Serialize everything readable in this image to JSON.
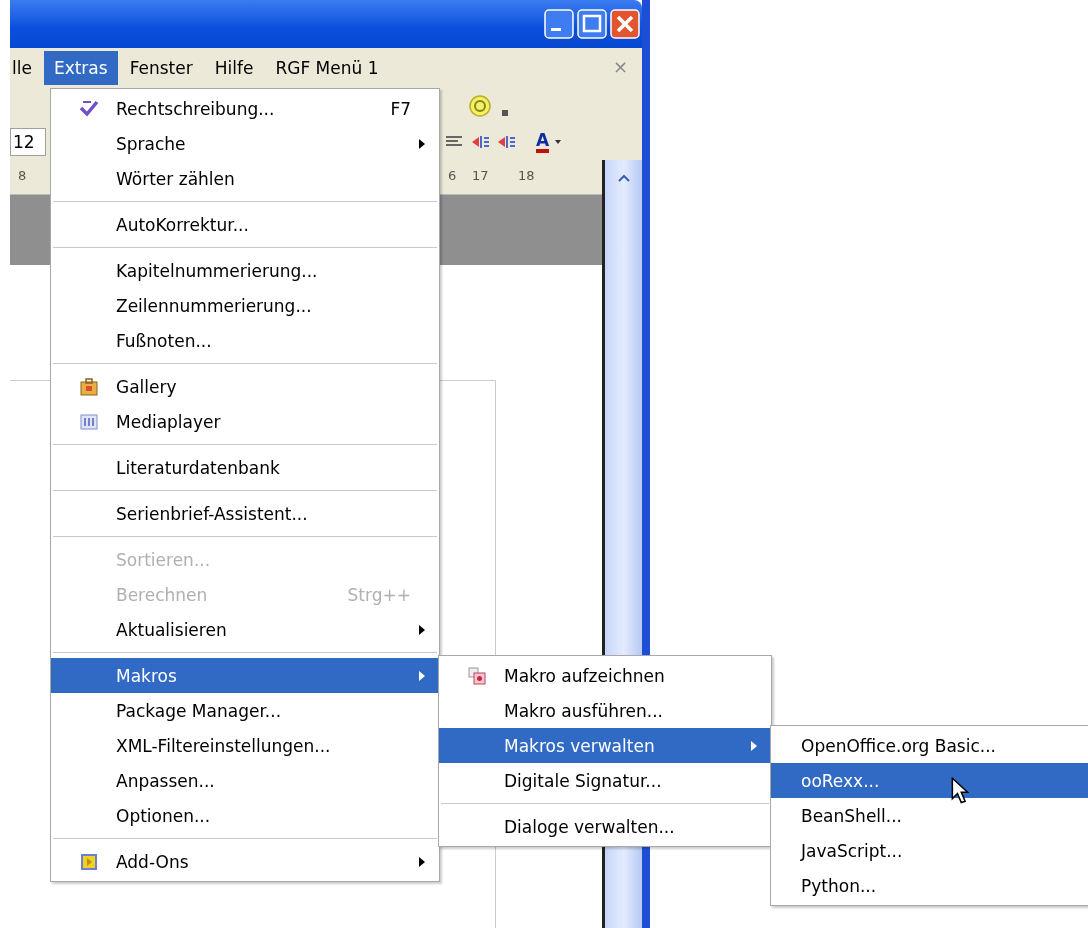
{
  "menubar": [
    {
      "label": "lle",
      "selected": false
    },
    {
      "label": "Extras",
      "selected": true
    },
    {
      "label": "Fenster",
      "selected": false
    },
    {
      "label": "Hilfe",
      "selected": false
    },
    {
      "label": "RGF Menü 1",
      "selected": false
    }
  ],
  "document_close": "×",
  "toolbar": {
    "font_size": "12",
    "font_color_glyph": "A"
  },
  "ruler": [
    "8",
    "6",
    "17",
    "18"
  ],
  "menus": [
    {
      "items": [
        {
          "kind": "item",
          "label": "Rechtschreibung...",
          "shortcut": "F7",
          "has_submenu": false,
          "selected": false,
          "disabled": false
        },
        {
          "kind": "item",
          "label": "Sprache",
          "has_submenu": true,
          "selected": false,
          "disabled": false
        },
        {
          "kind": "item",
          "label": "Wörter zählen",
          "has_submenu": false,
          "selected": false,
          "disabled": false
        },
        {
          "kind": "separator"
        },
        {
          "kind": "item",
          "label": "AutoKorrektur...",
          "has_submenu": false,
          "selected": false,
          "disabled": false
        },
        {
          "kind": "separator"
        },
        {
          "kind": "item",
          "label": "Kapitelnummerierung...",
          "has_submenu": false,
          "selected": false,
          "disabled": false
        },
        {
          "kind": "item",
          "label": "Zeilennummerierung...",
          "has_submenu": false,
          "selected": false,
          "disabled": false
        },
        {
          "kind": "item",
          "label": "Fußnoten...",
          "has_submenu": false,
          "selected": false,
          "disabled": false
        },
        {
          "kind": "separator"
        },
        {
          "kind": "item",
          "label": "Gallery",
          "has_submenu": false,
          "selected": false,
          "disabled": false
        },
        {
          "kind": "item",
          "label": "Mediaplayer",
          "has_submenu": false,
          "selected": false,
          "disabled": false
        },
        {
          "kind": "separator"
        },
        {
          "kind": "item",
          "label": "Literaturdatenbank",
          "has_submenu": false,
          "selected": false,
          "disabled": false
        },
        {
          "kind": "separator"
        },
        {
          "kind": "item",
          "label": "Serienbrief-Assistent...",
          "has_submenu": false,
          "selected": false,
          "disabled": false
        },
        {
          "kind": "separator"
        },
        {
          "kind": "item",
          "label": "Sortieren...",
          "has_submenu": false,
          "selected": false,
          "disabled": true
        },
        {
          "kind": "item",
          "label": "Berechnen",
          "shortcut": "Strg++",
          "has_submenu": false,
          "selected": false,
          "disabled": true
        },
        {
          "kind": "item",
          "label": "Aktualisieren",
          "has_submenu": true,
          "selected": false,
          "disabled": false
        },
        {
          "kind": "separator"
        },
        {
          "kind": "item",
          "label": "Makros",
          "has_submenu": true,
          "selected": true,
          "disabled": false
        },
        {
          "kind": "item",
          "label": "Package Manager...",
          "has_submenu": false,
          "selected": false,
          "disabled": false
        },
        {
          "kind": "item",
          "label": "XML-Filtereinstellungen...",
          "has_submenu": false,
          "selected": false,
          "disabled": false
        },
        {
          "kind": "item",
          "label": "Anpassen...",
          "has_submenu": false,
          "selected": false,
          "disabled": false
        },
        {
          "kind": "item",
          "label": "Optionen...",
          "has_submenu": false,
          "selected": false,
          "disabled": false
        },
        {
          "kind": "separator"
        },
        {
          "kind": "item",
          "label": "Add-Ons",
          "has_submenu": true,
          "selected": false,
          "disabled": false
        }
      ]
    },
    {
      "items": [
        {
          "kind": "item",
          "label": "Makro aufzeichnen",
          "has_submenu": false,
          "selected": false,
          "disabled": false
        },
        {
          "kind": "item",
          "label": "Makro ausführen...",
          "has_submenu": false,
          "selected": false,
          "disabled": false
        },
        {
          "kind": "item",
          "label": "Makros verwalten",
          "has_submenu": true,
          "selected": true,
          "disabled": false
        },
        {
          "kind": "item",
          "label": "Digitale Signatur...",
          "has_submenu": false,
          "selected": false,
          "disabled": false
        },
        {
          "kind": "separator"
        },
        {
          "kind": "item",
          "label": "Dialoge verwalten...",
          "has_submenu": false,
          "selected": false,
          "disabled": false
        }
      ]
    },
    {
      "items": [
        {
          "kind": "item",
          "label": "OpenOffice.org Basic...",
          "has_submenu": false,
          "selected": false,
          "disabled": false
        },
        {
          "kind": "item",
          "label": "ooRexx...",
          "has_submenu": false,
          "selected": true,
          "disabled": false
        },
        {
          "kind": "item",
          "label": "BeanShell...",
          "has_submenu": false,
          "selected": false,
          "disabled": false
        },
        {
          "kind": "item",
          "label": "JavaScript...",
          "has_submenu": false,
          "selected": false,
          "disabled": false
        },
        {
          "kind": "item",
          "label": "Python...",
          "has_submenu": false,
          "selected": false,
          "disabled": false
        }
      ]
    }
  ]
}
